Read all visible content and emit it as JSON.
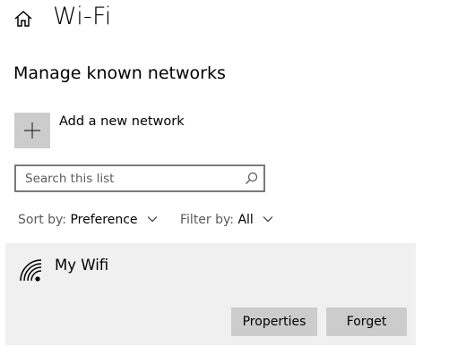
{
  "header": {
    "title": "Wi-Fi",
    "home_icon": "home-icon"
  },
  "section": {
    "title": "Manage known networks"
  },
  "add_network": {
    "label": "Add a new network",
    "icon": "plus-icon"
  },
  "search": {
    "value": "",
    "placeholder": "Search this list",
    "icon": "search-icon"
  },
  "sort": {
    "label": "Sort by:",
    "value": "Preference"
  },
  "filter": {
    "label": "Filter by:",
    "value": "All"
  },
  "networks": [
    {
      "name": "My Wifi",
      "icon": "wifi-secured-icon",
      "properties_label": "Properties",
      "forget_label": "Forget"
    }
  ],
  "colors": {
    "card_background": "#f0f0f0",
    "button_background": "#cccccc",
    "add_tile_background": "#cccccc",
    "search_border": "#7a7a7a"
  }
}
